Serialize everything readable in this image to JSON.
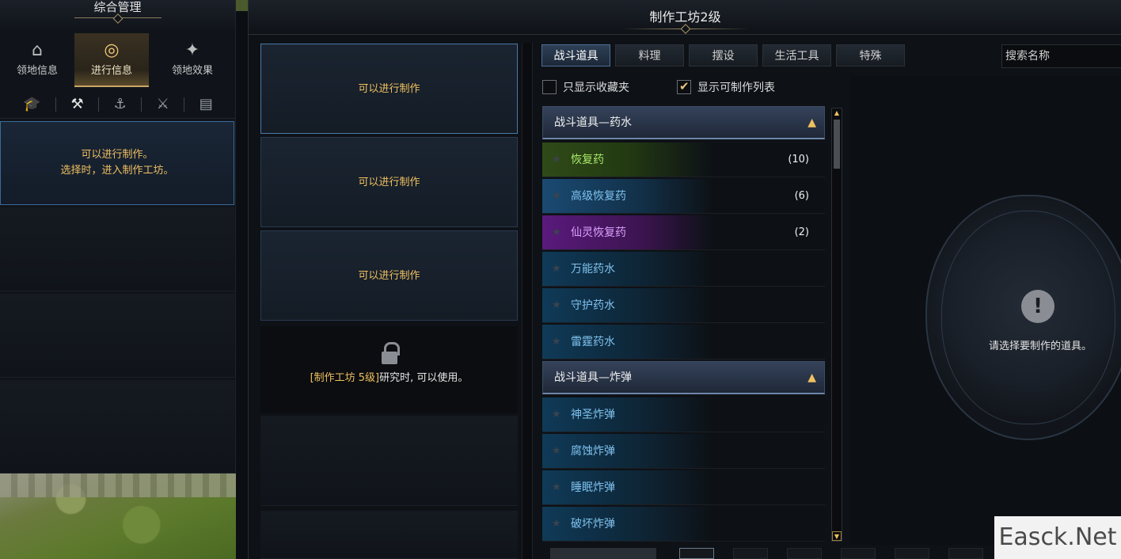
{
  "left_panel": {
    "title": "综合管理",
    "tabs": [
      {
        "label": "领地信息",
        "icon": "castle-icon"
      },
      {
        "label": "进行信息",
        "icon": "compass-icon"
      },
      {
        "label": "领地效果",
        "icon": "sparkle-icon"
      }
    ],
    "iconbar": [
      "graduation-cap-icon",
      "crossed-tools-icon",
      "anchor-icon",
      "crossed-swords-icon",
      "book-icon"
    ],
    "info_line1": "可以进行制作。",
    "info_line2": "选择时，进入制作工坊。"
  },
  "window": {
    "title": "制作工坊2级"
  },
  "slots": {
    "ready_label": "可以进行制作",
    "locked_highlight": "[制作工坊 5级]",
    "locked_rest": "研究时, 可以使用。"
  },
  "category_tabs": [
    "战斗道具",
    "料理",
    "摆设",
    "生活工具",
    "特殊"
  ],
  "search": {
    "placeholder": "搜索名称"
  },
  "filters": {
    "favorites_label": "只显示收藏夹",
    "favorites_checked": false,
    "craftable_label": "显示可制作列表",
    "craftable_checked": true
  },
  "groups": [
    {
      "title": "战斗道具—药水",
      "items": [
        {
          "name": "恢复药",
          "count": "(10)",
          "grade": "green"
        },
        {
          "name": "高级恢复药",
          "count": "(6)",
          "grade": "blue"
        },
        {
          "name": "仙灵恢复药",
          "count": "(2)",
          "grade": "purple"
        },
        {
          "name": "万能药水",
          "count": "",
          "grade": "blue"
        },
        {
          "name": "守护药水",
          "count": "",
          "grade": "blue"
        },
        {
          "name": "雷霆药水",
          "count": "",
          "grade": "blue"
        }
      ]
    },
    {
      "title": "战斗道具—炸弹",
      "items": [
        {
          "name": "神圣炸弹",
          "count": "",
          "grade": "blue"
        },
        {
          "name": "腐蚀炸弹",
          "count": "",
          "grade": "blue"
        },
        {
          "name": "睡眠炸弹",
          "count": "",
          "grade": "blue"
        },
        {
          "name": "破坏炸弹",
          "count": "",
          "grade": "blue"
        }
      ]
    }
  ],
  "detail": {
    "hint": "请选择要制作的道具。"
  },
  "watermark": "Easck.Net",
  "colors": {
    "accent_gold": "#f0c060",
    "tab_active_blue": "#4d6f96",
    "grade_green": "#a8e86a",
    "grade_blue": "#7fc2ee",
    "grade_purple": "#dba0ff"
  }
}
